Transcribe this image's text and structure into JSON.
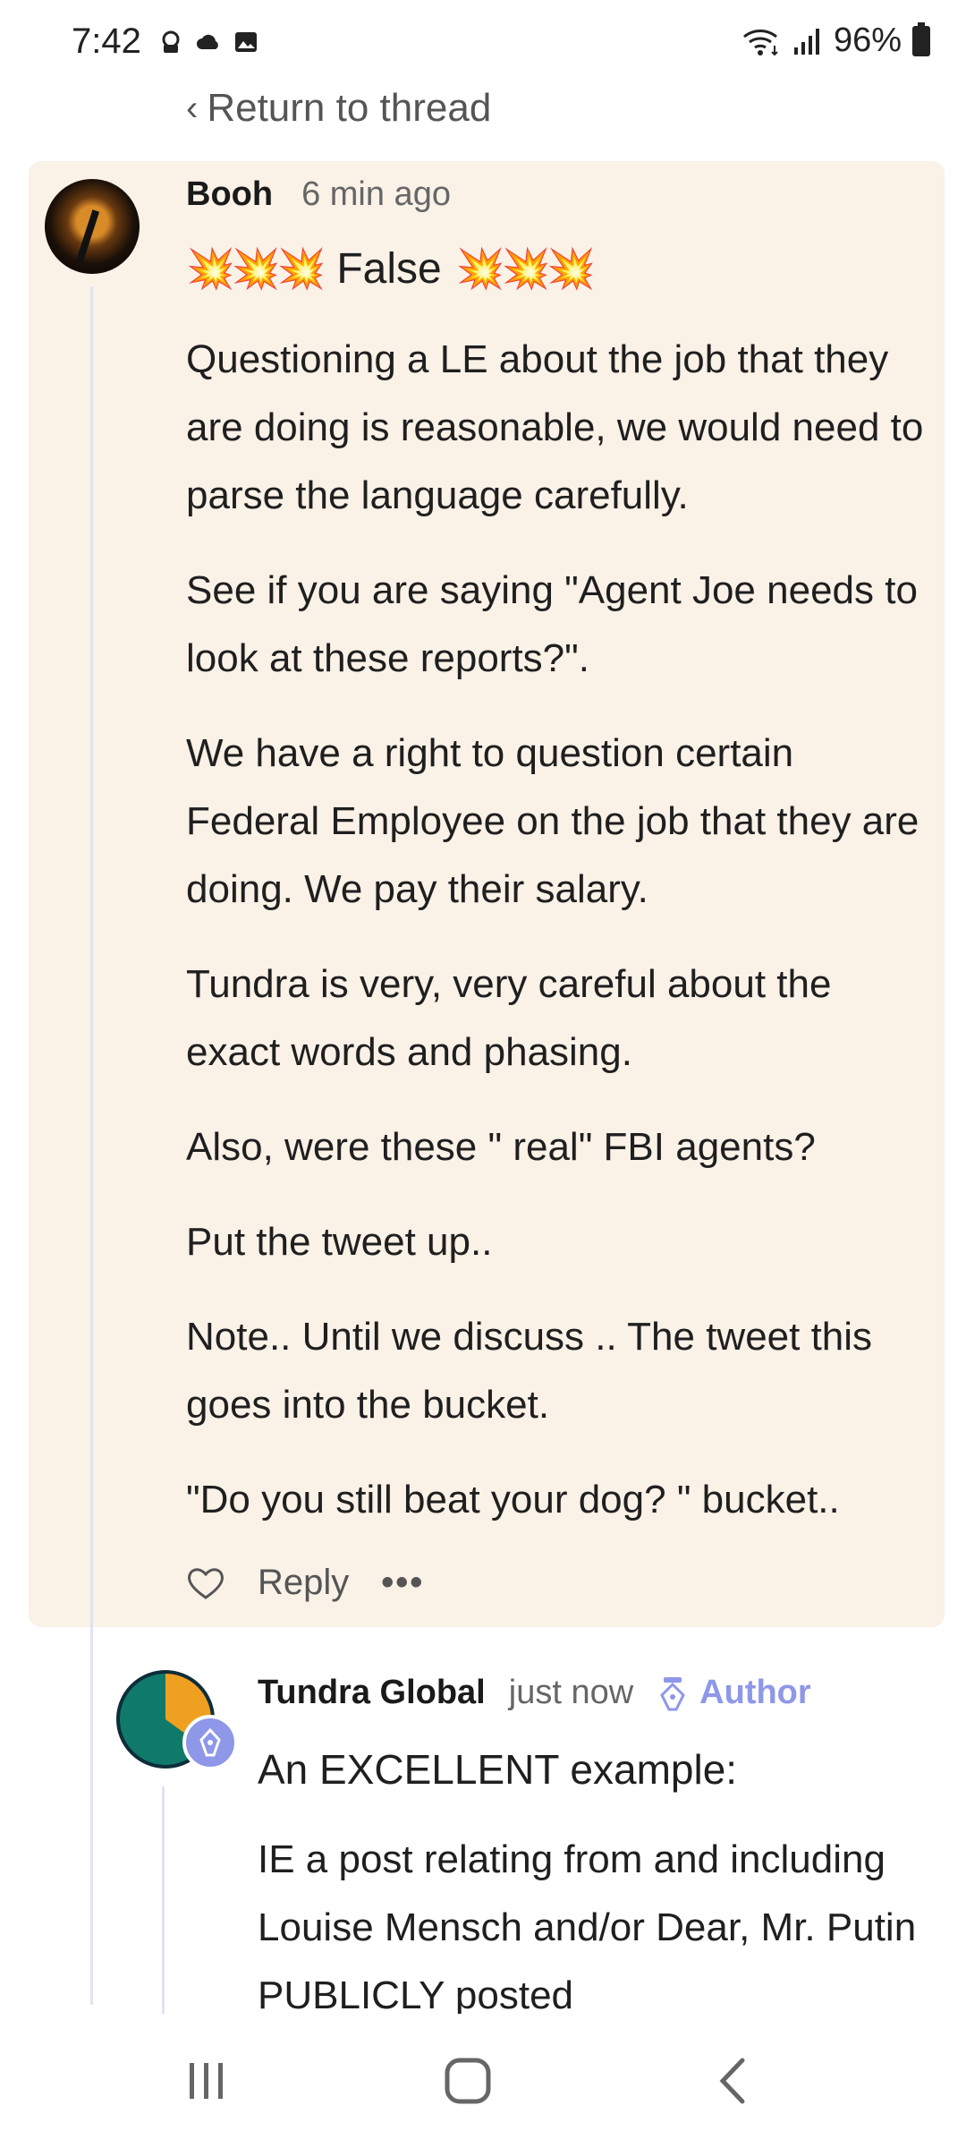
{
  "status_bar": {
    "time": "7:42",
    "battery": "96%",
    "left_icons": [
      "vpn-icon",
      "cloud-icon",
      "gallery-icon"
    ],
    "right_icons": [
      "wifi-icon",
      "signal-icon",
      "battery-icon"
    ]
  },
  "nav": {
    "return_label": "Return to thread"
  },
  "comment": {
    "author": "Booh",
    "time": "6 min ago",
    "headline_emojis_left": "💥💥💥",
    "headline_text": "False",
    "headline_emojis_right": "💥💥💥",
    "paragraphs": [
      "Questioning a LE about the job that they are doing is reasonable, we would need to parse the language carefully.",
      "See if you are saying \"Agent Joe needs to look at these reports?\".",
      "We have a right to question certain Federal Employee on the job that they are doing. We pay their salary.",
      "Tundra is very, very careful about the exact words and phasing.",
      "Also, were these \" real\" FBI agents?",
      "Put the tweet up..",
      "Note.. Until we discuss .. The tweet this goes into the bucket.",
      "\"Do you still beat your dog? \" bucket.."
    ],
    "actions": {
      "like_icon": "heart-icon",
      "reply_label": "Reply",
      "more_label": "•••"
    }
  },
  "reply": {
    "author": "Tundra Global",
    "time": "just now",
    "badge_label": "Author",
    "badge_icon": "pen-nib-icon",
    "lead": "An EXCELLENT example:",
    "paragraph": "IE a post relating from and including Louise Mensch and/or Dear, Mr. Putin PUBLICLY posted"
  },
  "colors": {
    "highlight_bg": "#faf1e7",
    "author_accent": "#8e97e8",
    "thread_line": "#dfe3f3"
  }
}
